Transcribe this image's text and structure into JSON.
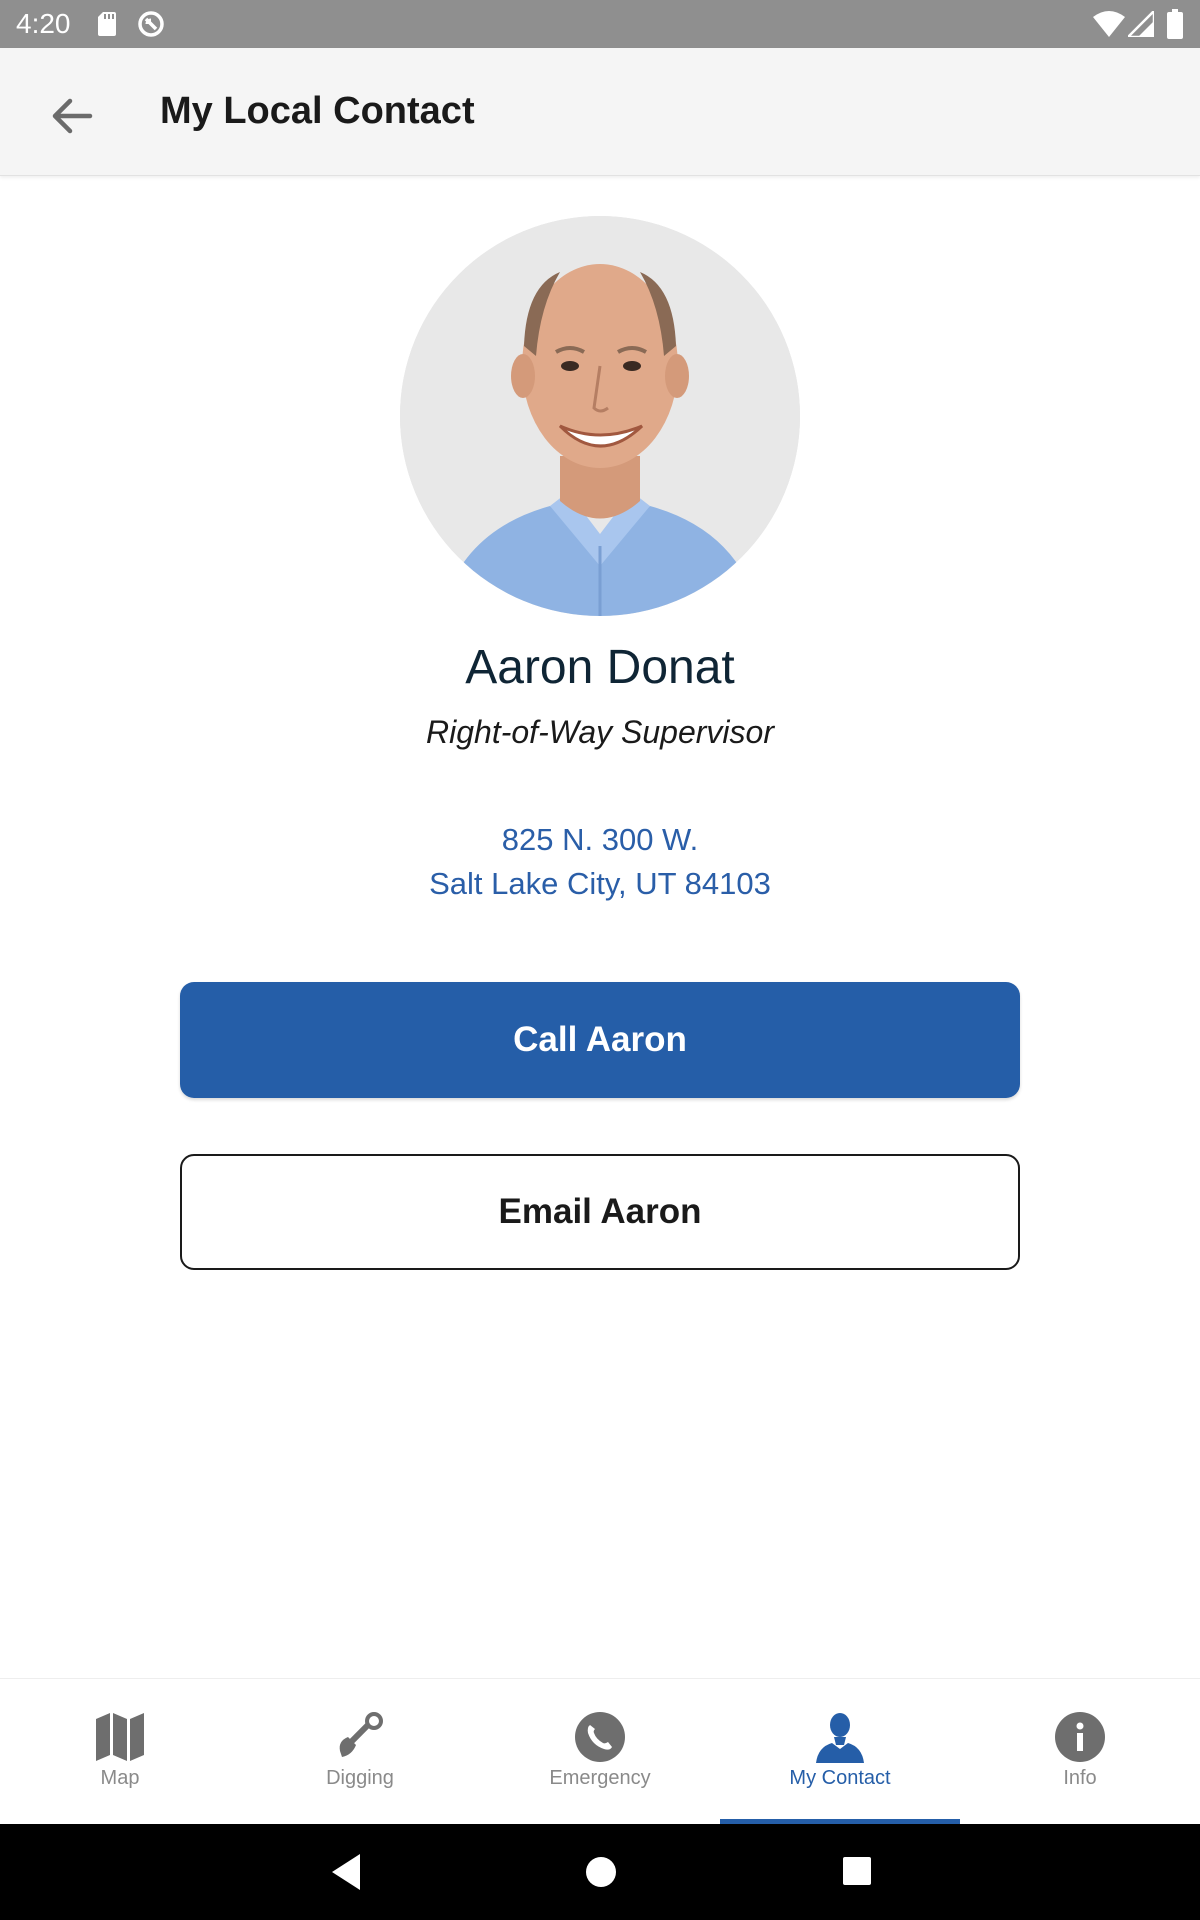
{
  "status_bar": {
    "time": "4:20"
  },
  "app_bar": {
    "title": "My Local Contact"
  },
  "contact": {
    "name": "Aaron Donat",
    "role": "Right-of-Way Supervisor",
    "address_line1": "825 N. 300 W.",
    "address_line2": "Salt Lake City, UT 84103",
    "call_label": "Call Aaron",
    "email_label": "Email Aaron"
  },
  "bottom_nav": {
    "items": [
      {
        "label": "Map",
        "icon": "map-icon",
        "active": false
      },
      {
        "label": "Digging",
        "icon": "shovel-icon",
        "active": false
      },
      {
        "label": "Emergency",
        "icon": "phone-icon",
        "active": false
      },
      {
        "label": "My Contact",
        "icon": "person-icon",
        "active": true
      },
      {
        "label": "Info",
        "icon": "info-icon",
        "active": false
      }
    ]
  },
  "colors": {
    "accent": "#255ea8",
    "status_bar": "#8f8f8f",
    "app_bar": "#f5f5f5",
    "nav_inactive": "#8a8a8a"
  }
}
